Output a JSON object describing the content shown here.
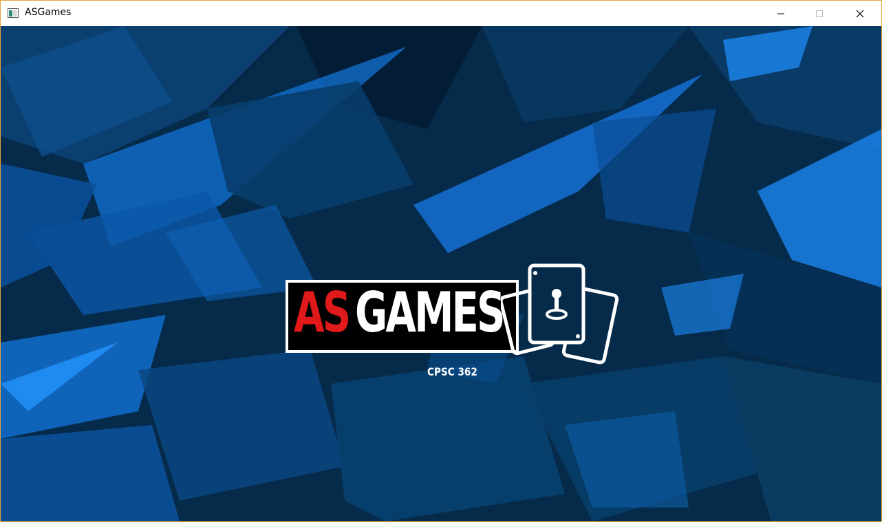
{
  "window": {
    "title": "ASGames",
    "controls": [
      "minimize-icon",
      "maximize-icon",
      "close-icon"
    ]
  },
  "logo": {
    "part1": "AS",
    "part2": "GAMES",
    "subtitle": "CPSC 362",
    "accent_color": "#e01a1a"
  },
  "background": {
    "base_color": "#062b4a",
    "highlight_color": "#0a6fd8"
  }
}
